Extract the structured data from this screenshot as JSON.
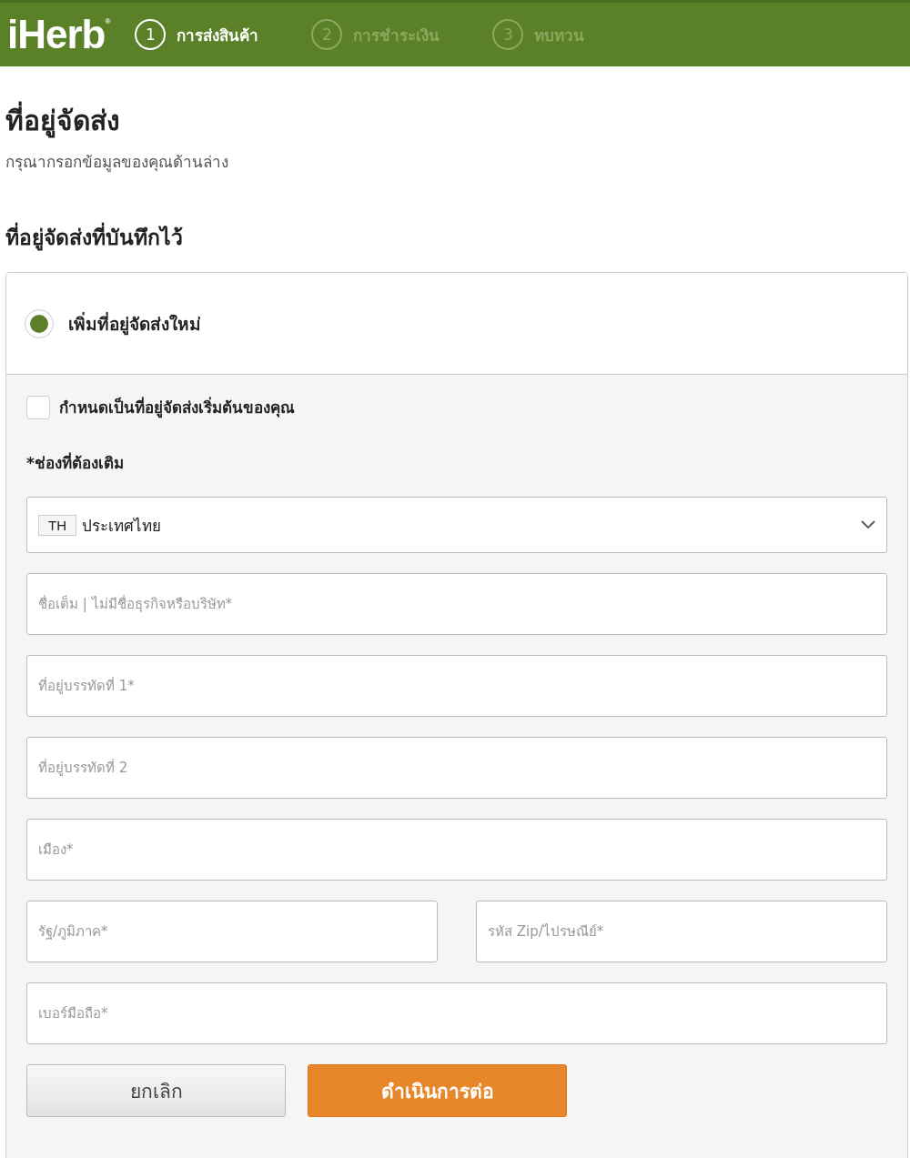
{
  "header": {
    "logo": "iHerb",
    "logo_mark": "®",
    "steps": [
      {
        "number": "1",
        "label": "การส่งสินค้า",
        "selected": true
      },
      {
        "number": "2",
        "label": "การชำระเงิน",
        "selected": false
      },
      {
        "number": "3",
        "label": "ทบทวน",
        "selected": false
      }
    ]
  },
  "title": "ที่อยู่จัดส่ง",
  "subtitle": "กรุณากรอกข้อมูลของคุณด้านล่าง",
  "saved_heading": "ที่อยู่จัดส่งที่บันทึกไว้",
  "new_address": {
    "label": "เพิ่มที่อยู่จัดส่งใหม่",
    "selected": true
  },
  "default_checkbox": {
    "label": "กำหนดเป็นที่อยู่จัดส่งเริ่มต้นของคุณ",
    "checked": false
  },
  "required_note": "*ช่องที่ต้องเติม",
  "country": {
    "code": "TH",
    "value": "ประเทศไทย"
  },
  "field_rows": [
    [
      {
        "placeholder": "ชื่อเต็ม | ไม่มีชื่อธุรกิจหรือบริษัท*"
      }
    ],
    [
      {
        "placeholder": "ที่อยู่บรรทัดที่ 1*"
      }
    ],
    [
      {
        "placeholder": "ที่อยู่บรรทัดที่ 2"
      }
    ],
    [
      {
        "placeholder": "เมือง*"
      }
    ],
    [
      {
        "placeholder": "รัฐ/ภูมิภาค*"
      },
      {
        "placeholder": "รหัส Zip/ไปรษณีย์*"
      }
    ],
    [
      {
        "placeholder": "เบอร์มือถือ*"
      }
    ]
  ],
  "buttons": [
    {
      "kind": "secondary",
      "label": "ยกเลิก"
    },
    {
      "kind": "primary",
      "label": "ดำเนินการต่อ"
    }
  ]
}
